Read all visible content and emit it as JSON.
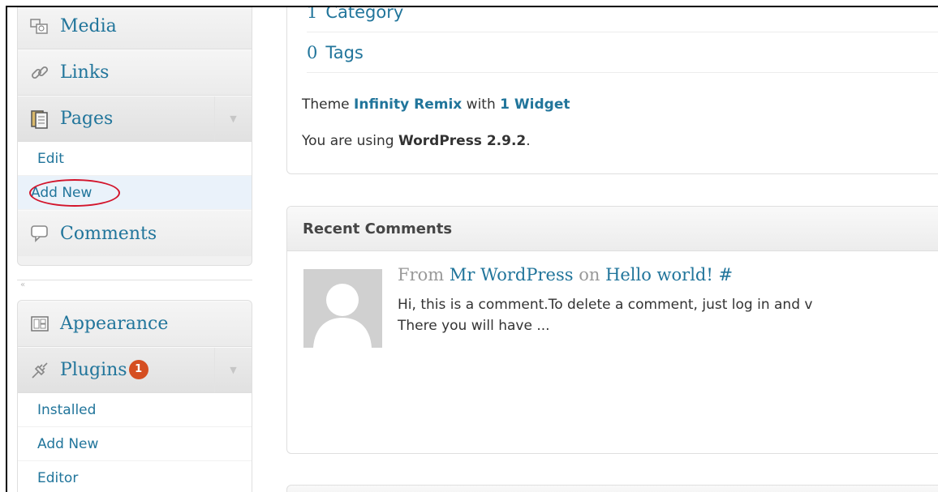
{
  "sidebar": {
    "media_label": "Media",
    "links_label": "Links",
    "pages_label": "Pages",
    "pages_sub": [
      "Edit",
      "Add New"
    ],
    "comments_label": "Comments",
    "collapse_glyph": "«",
    "appearance_label": "Appearance",
    "plugins_label": "Plugins",
    "plugins_badge": "1",
    "plugins_sub": [
      "Installed",
      "Add New",
      "Editor"
    ],
    "toggle_glyph": "▼"
  },
  "right_now": {
    "category_count": "1",
    "category_label": "Category",
    "tags_count": "0",
    "tags_label": "Tags",
    "theme_prefix": "Theme",
    "theme_name": "Infinity Remix",
    "theme_with": "with",
    "widget_text": "1 Widget",
    "version_prefix": "You are using",
    "version_name": "WordPress 2.9.2",
    "version_suffix": "."
  },
  "recent_comments": {
    "title": "Recent Comments",
    "from": "From",
    "author": "Mr WordPress",
    "on": "on",
    "post": "Hello world!",
    "hash": "#",
    "line1": "Hi, this is a comment.To delete a comment, just log in and v",
    "line2": "There you will have ..."
  },
  "colors": {
    "link": "#21759b",
    "badge": "#d54e21",
    "highlight": "#d3152c"
  }
}
